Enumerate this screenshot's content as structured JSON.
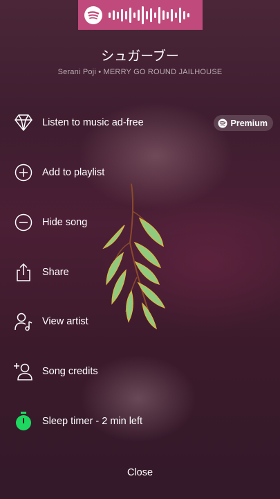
{
  "song": {
    "title": "シュガーブー",
    "subtitle": "Serani Poji • MERRY GO ROUND JAILHOUSE"
  },
  "menu": [
    {
      "label": "Listen to music ad-free",
      "icon": "diamond-icon"
    },
    {
      "label": "Add to playlist",
      "icon": "plus-circle-icon"
    },
    {
      "label": "Hide song",
      "icon": "minus-circle-icon"
    },
    {
      "label": "Share",
      "icon": "share-icon"
    },
    {
      "label": "View artist",
      "icon": "artist-icon"
    },
    {
      "label": "Song credits",
      "icon": "add-person-icon"
    },
    {
      "label": "Sleep timer - 2 min left",
      "icon": "timer-icon"
    }
  ],
  "premium_badge": "Premium",
  "close_label": "Close",
  "colors": {
    "banner": "#c04a7c",
    "timer_active": "#1ed760",
    "background_top": "#4a2638",
    "background_bottom": "#33192a"
  }
}
